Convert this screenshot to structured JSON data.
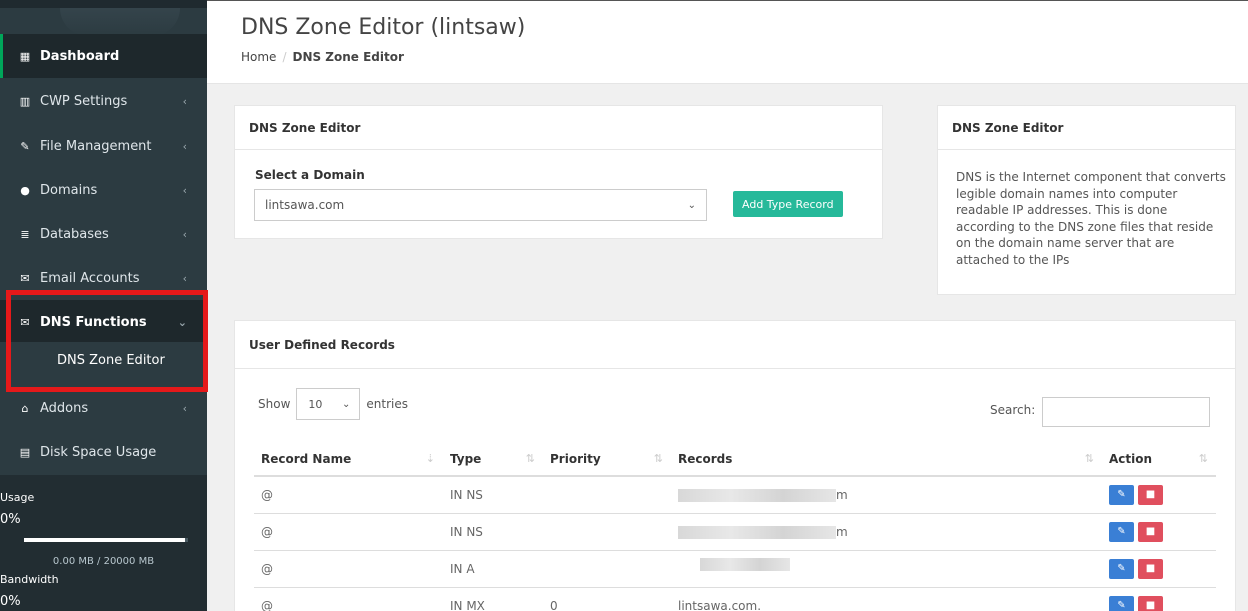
{
  "sidebar": {
    "items": [
      {
        "label": "Dashboard",
        "icon": "grid-icon",
        "glyph": "▦"
      },
      {
        "label": "CWP Settings",
        "icon": "bar-chart-icon",
        "glyph": "▥"
      },
      {
        "label": "File Management",
        "icon": "edit-icon",
        "glyph": "✎"
      },
      {
        "label": "Domains",
        "icon": "globe-icon",
        "glyph": "●"
      },
      {
        "label": "Databases",
        "icon": "database-icon",
        "glyph": "≣"
      },
      {
        "label": "Email Accounts",
        "icon": "envelope-icon",
        "glyph": "✉"
      },
      {
        "label": "DNS Functions",
        "icon": "envelope-icon",
        "glyph": "✉"
      },
      {
        "label": "Addons",
        "icon": "bank-icon",
        "glyph": "⌂"
      },
      {
        "label": "Disk Space Usage",
        "icon": "server-icon",
        "glyph": "▤"
      }
    ],
    "sub_item": "DNS Zone Editor",
    "usage_label": "Usage",
    "usage_pct": "0%",
    "usage_mb": "0.00 MB / 20000 MB",
    "usage_fraction": 0.98,
    "bandwidth_label": "Bandwidth",
    "bandwidth_pct": "0%",
    "chevron_left": "‹",
    "chevron_down": "⌄"
  },
  "header": {
    "title": "DNS Zone Editor (lintsaw)",
    "breadcrumb_home": "Home",
    "breadcrumb_sep": "/",
    "breadcrumb_current": "DNS Zone Editor"
  },
  "editor_panel": {
    "title": "DNS Zone Editor",
    "select_label": "Select a Domain",
    "selected_domain": "lintsawa.com",
    "add_button": "Add Type Record"
  },
  "info_panel": {
    "title": "DNS Zone Editor",
    "text": "DNS is the Internet component that converts legible domain names into computer readable IP addresses. This is done according to the DNS zone files that reside on the domain name server that are attached to the IPs"
  },
  "records_panel": {
    "title": "User Defined Records",
    "show_label": "Show",
    "entries_value": "10",
    "entries_label": "entries",
    "search_label": "Search:",
    "columns": [
      "Record Name",
      "Type",
      "Priority",
      "Records",
      "Action"
    ],
    "rows": [
      {
        "name": "@",
        "type": "IN NS",
        "priority": "",
        "record": "m",
        "redacted": true
      },
      {
        "name": "@",
        "type": "IN NS",
        "priority": "",
        "record": "m",
        "redacted": true
      },
      {
        "name": "@",
        "type": "IN A",
        "priority": "",
        "record": "",
        "redacted": true
      },
      {
        "name": "@",
        "type": "IN MX",
        "priority": "0",
        "record": "lintsawa.com.",
        "redacted": false
      }
    ]
  },
  "colors": {
    "sidebar_bg": "#2c3b41",
    "accent_green": "#26b99a",
    "edit_blue": "#3a7fd5",
    "delete_red": "#e04f5e",
    "highlight_red": "#e5191a"
  }
}
